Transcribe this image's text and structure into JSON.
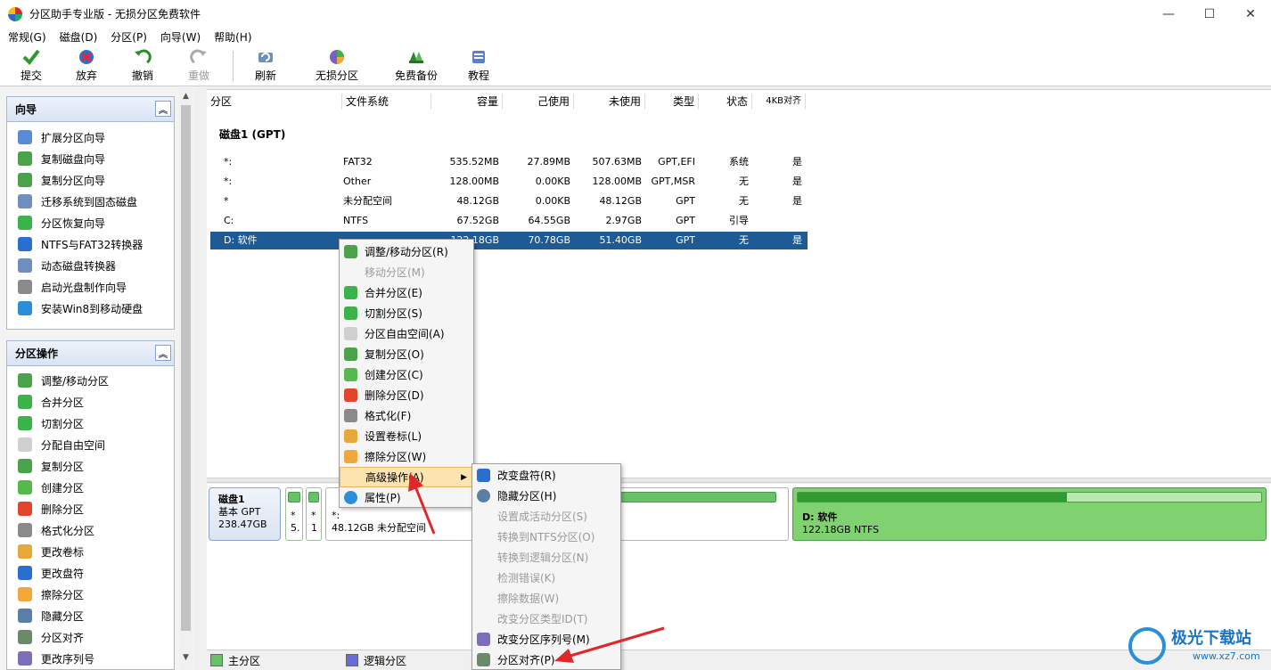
{
  "window": {
    "title": "分区助手专业版 - 无损分区免费软件",
    "minimize": "—",
    "maximize": "☐",
    "close": "✕"
  },
  "menu": [
    "常规(G)",
    "磁盘(D)",
    "分区(P)",
    "向导(W)",
    "帮助(H)"
  ],
  "toolbar": {
    "submit": "提交",
    "discard": "放弃",
    "undo": "撤销",
    "redo": "重做",
    "refresh": "刷新",
    "lossless": "无损分区",
    "backup": "免费备份",
    "tutorial": "教程"
  },
  "sidebar": {
    "wizard_title": "向导",
    "wizard_items": [
      "扩展分区向导",
      "复制磁盘向导",
      "复制分区向导",
      "迁移系统到固态磁盘",
      "分区恢复向导",
      "NTFS与FAT32转换器",
      "动态磁盘转换器",
      "启动光盘制作向导",
      "安装Win8到移动硬盘"
    ],
    "ops_title": "分区操作",
    "ops_items": [
      "调整/移动分区",
      "合并分区",
      "切割分区",
      "分配自由空间",
      "复制分区",
      "创建分区",
      "删除分区",
      "格式化分区",
      "更改卷标",
      "更改盘符",
      "擦除分区",
      "隐藏分区",
      "分区对齐",
      "更改序列号"
    ]
  },
  "table": {
    "headers": [
      "分区",
      "文件系统",
      "容量",
      "己使用",
      "未使用",
      "类型",
      "状态",
      "4KB对齐"
    ],
    "disk_label": "磁盘1 (GPT)",
    "rows": [
      {
        "name": "*:",
        "fs": "FAT32",
        "cap": "535.52MB",
        "used": "27.89MB",
        "free": "507.63MB",
        "type": "GPT,EFI",
        "status": "系统",
        "align": "是"
      },
      {
        "name": "*:",
        "fs": "Other",
        "cap": "128.00MB",
        "used": "0.00KB",
        "free": "128.00MB",
        "type": "GPT,MSR",
        "status": "无",
        "align": "是"
      },
      {
        "name": "*",
        "fs": "未分配空间",
        "cap": "48.12GB",
        "used": "0.00KB",
        "free": "48.12GB",
        "type": "GPT",
        "status": "无",
        "align": "是"
      },
      {
        "name": "C:",
        "fs": "NTFS",
        "cap": "67.52GB",
        "used": "64.55GB",
        "free": "2.97GB",
        "type": "GPT",
        "status": "引导",
        "align": ""
      },
      {
        "name": "D: 软件",
        "fs": "",
        "cap": "122.18GB",
        "used": "70.78GB",
        "free": "51.40GB",
        "type": "GPT",
        "status": "无",
        "align": "是"
      }
    ]
  },
  "diskmap": {
    "disk_name": "磁盘1",
    "disk_type": "基本 GPT",
    "disk_size": "238.47GB",
    "p1_label": "*",
    "p1_size": "5.",
    "p2_label": "*",
    "p2_size": "1",
    "p3_label": "*:",
    "p3_desc": "48.12GB 未分配空间",
    "d_label": "D: 软件",
    "d_desc": "122.18GB NTFS",
    "c_fill": 0.96,
    "d_fill": 0.58
  },
  "status": {
    "primary": "主分区",
    "logical": "逻辑分区"
  },
  "context_menu": [
    {
      "label": "调整/移动分区(R)",
      "disabled": false
    },
    {
      "label": "移动分区(M)",
      "disabled": true
    },
    {
      "label": "合并分区(E)",
      "disabled": false
    },
    {
      "label": "切割分区(S)",
      "disabled": false
    },
    {
      "label": "分区自由空间(A)",
      "disabled": false
    },
    {
      "label": "复制分区(O)",
      "disabled": false
    },
    {
      "label": "创建分区(C)",
      "disabled": false
    },
    {
      "label": "删除分区(D)",
      "disabled": false
    },
    {
      "label": "格式化(F)",
      "disabled": false
    },
    {
      "label": "设置卷标(L)",
      "disabled": false
    },
    {
      "label": "擦除分区(W)",
      "disabled": false
    },
    {
      "label": "高级操作(A)",
      "disabled": false
    },
    {
      "label": "属性(P)",
      "disabled": false
    }
  ],
  "submenu": [
    {
      "label": "改变盘符(R)",
      "disabled": false
    },
    {
      "label": "隐藏分区(H)",
      "disabled": false
    },
    {
      "label": "设置成活动分区(S)",
      "disabled": true
    },
    {
      "label": "转换到NTFS分区(O)",
      "disabled": true
    },
    {
      "label": "转换到逻辑分区(N)",
      "disabled": true
    },
    {
      "label": "检测错误(K)",
      "disabled": true
    },
    {
      "label": "擦除数据(W)",
      "disabled": true
    },
    {
      "label": "改变分区类型ID(T)",
      "disabled": true
    },
    {
      "label": "改变分区序列号(M)",
      "disabled": false
    },
    {
      "label": "分区对齐(P)",
      "disabled": false
    }
  ],
  "watermark": {
    "title": "极光下载站",
    "url": "www.xz7.com"
  },
  "colors": {
    "selected_row": "#1e5a96",
    "primary_partition": "#67c267",
    "logical_partition": "#6a6adb",
    "menu_highlight": "#fbe4b0",
    "annotation_arrow": "#e0282b"
  }
}
